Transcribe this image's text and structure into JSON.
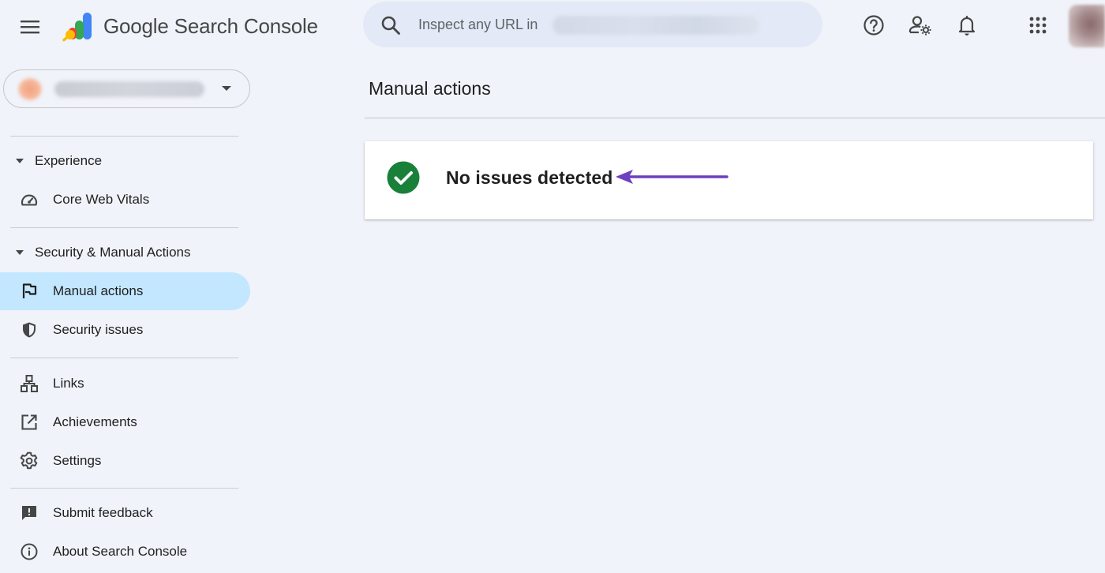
{
  "header": {
    "product_brand": "Google",
    "product_name": "Search Console",
    "search_placeholder": "Inspect any URL in",
    "icons": [
      "menu-icon",
      "search-icon",
      "help-icon",
      "manage-users-icon",
      "notifications-icon",
      "apps-grid-icon"
    ]
  },
  "sidebar": {
    "sections": [
      {
        "label": "Experience",
        "items": [
          {
            "label": "Core Web Vitals",
            "icon": "gauge-icon"
          }
        ]
      },
      {
        "label": "Security & Manual Actions",
        "items": [
          {
            "label": "Manual actions",
            "icon": "flag-icon",
            "active": true
          },
          {
            "label": "Security issues",
            "icon": "shield-icon"
          }
        ]
      }
    ],
    "misc": [
      {
        "label": "Links",
        "icon": "sitemap-icon"
      },
      {
        "label": "Achievements",
        "icon": "open-in-new-icon"
      },
      {
        "label": "Settings",
        "icon": "gear-icon"
      }
    ],
    "footer": [
      {
        "label": "Submit feedback",
        "icon": "feedback-icon"
      },
      {
        "label": "About Search Console",
        "icon": "info-icon"
      }
    ]
  },
  "main": {
    "title": "Manual actions",
    "status_text": "No issues detected"
  },
  "colors": {
    "background": "#f0f3f9",
    "search_bg": "#e3e9f6",
    "active_nav": "#c2e7ff",
    "success_green": "#188038",
    "annotation_arrow": "#6e3fbf"
  }
}
